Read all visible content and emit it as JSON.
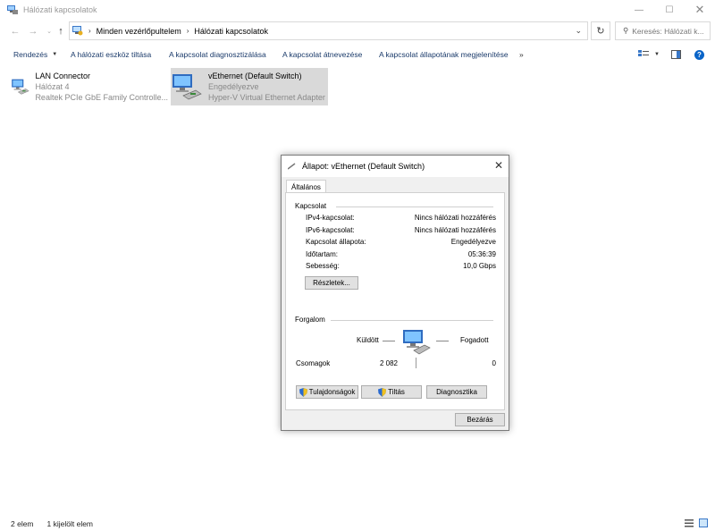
{
  "window": {
    "title": "Hálózati kapcsolatok",
    "icons": {
      "app": "network-connections-icon",
      "minimize": "minimize-icon",
      "maximize": "maximize-icon",
      "close": "close-icon"
    }
  },
  "address": {
    "crumbs": [
      "Minden vezérlőpultelem",
      "Hálózati kapcsolatok"
    ],
    "search_placeholder": "Keresés: Hálózati k..."
  },
  "commands": {
    "organize": "Rendezés",
    "disable": "A hálózati eszköz tiltása",
    "diagnose": "A kapcsolat diagnosztizálása",
    "rename": "A kapcsolat átnevezése",
    "view_status": "A kapcsolat állapotának megjelenítése",
    "more": "»"
  },
  "connections": [
    {
      "name": "LAN Connector",
      "network": "Hálózat 4",
      "adapter": "Realtek PCIe GbE Family Controlle..."
    },
    {
      "name": "vEthernet (Default Switch)",
      "network": "Engedélyezve",
      "adapter": "Hyper-V Virtual Ethernet Adapter"
    }
  ],
  "dialog": {
    "title": "Állapot: vEthernet (Default Switch)",
    "tab": "Általános",
    "connection_group": "Kapcsolat",
    "rows": [
      {
        "label": "IPv4-kapcsolat:",
        "value": "Nincs hálózati hozzáférés"
      },
      {
        "label": "IPv6-kapcsolat:",
        "value": "Nincs hálózati hozzáférés"
      },
      {
        "label": "Kapcsolat állapota:",
        "value": "Engedélyezve"
      },
      {
        "label": "Időtartam:",
        "value": "05:36:39"
      },
      {
        "label": "Sebesség:",
        "value": "10,0 Gbps"
      }
    ],
    "details_button": "Részletek...",
    "traffic_group": "Forgalom",
    "sent_label": "Küldött",
    "received_label": "Fogadott",
    "packets_label": "Csomagok",
    "packets_sent": "2 082",
    "packets_received": "0",
    "properties_button": "Tulajdonságok",
    "disable_button": "Tiltás",
    "diagnose_button": "Diagnosztika",
    "close_button": "Bezárás"
  },
  "status": {
    "item_count": "2 elem",
    "selected": "1 kijelölt elem"
  },
  "colors": {
    "accent": "#0078d7",
    "selected": "#d9d9d9",
    "link": "#1a3a6a"
  }
}
